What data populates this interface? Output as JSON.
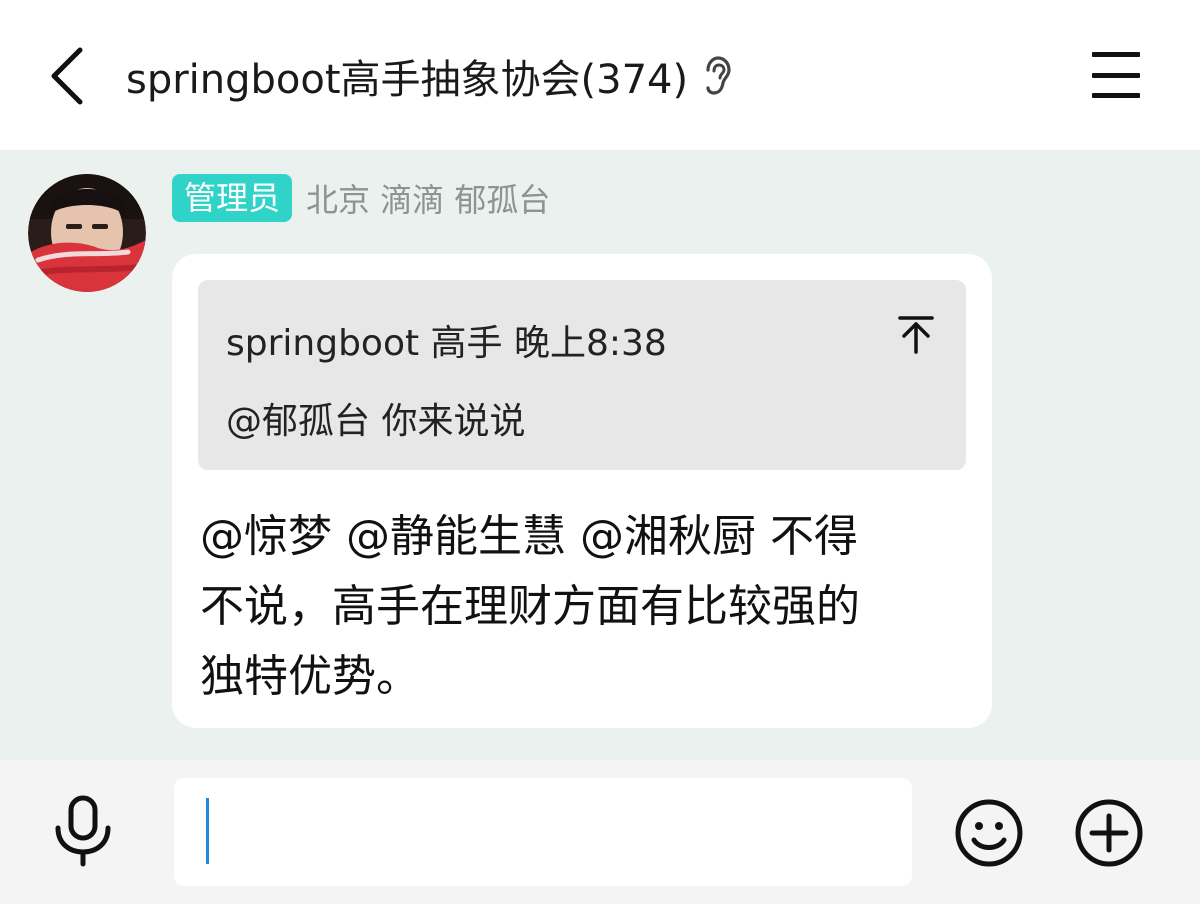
{
  "header": {
    "title": "springboot高手抽象协会(374)"
  },
  "message": {
    "badge": "管理员",
    "sender": "北京 滴滴 郁孤台",
    "quote": {
      "head": "springboot 高手 晚上8:38",
      "body": "@郁孤台 你来说说"
    },
    "text_lines": [
      "@惊梦 @静能生慧 @湘秋厨 不得",
      "不说，高手在理财方面有比较强的",
      "独特优势。"
    ]
  },
  "colors": {
    "badge": "#2fd3c8",
    "chat_background": "#eaf1ee",
    "caret": "#1e88e5"
  },
  "icons": [
    "back-arrow-icon",
    "ear-icon",
    "menu-icon",
    "scroll-to-top-icon",
    "microphone-icon",
    "emoji-icon",
    "plus-icon"
  ]
}
